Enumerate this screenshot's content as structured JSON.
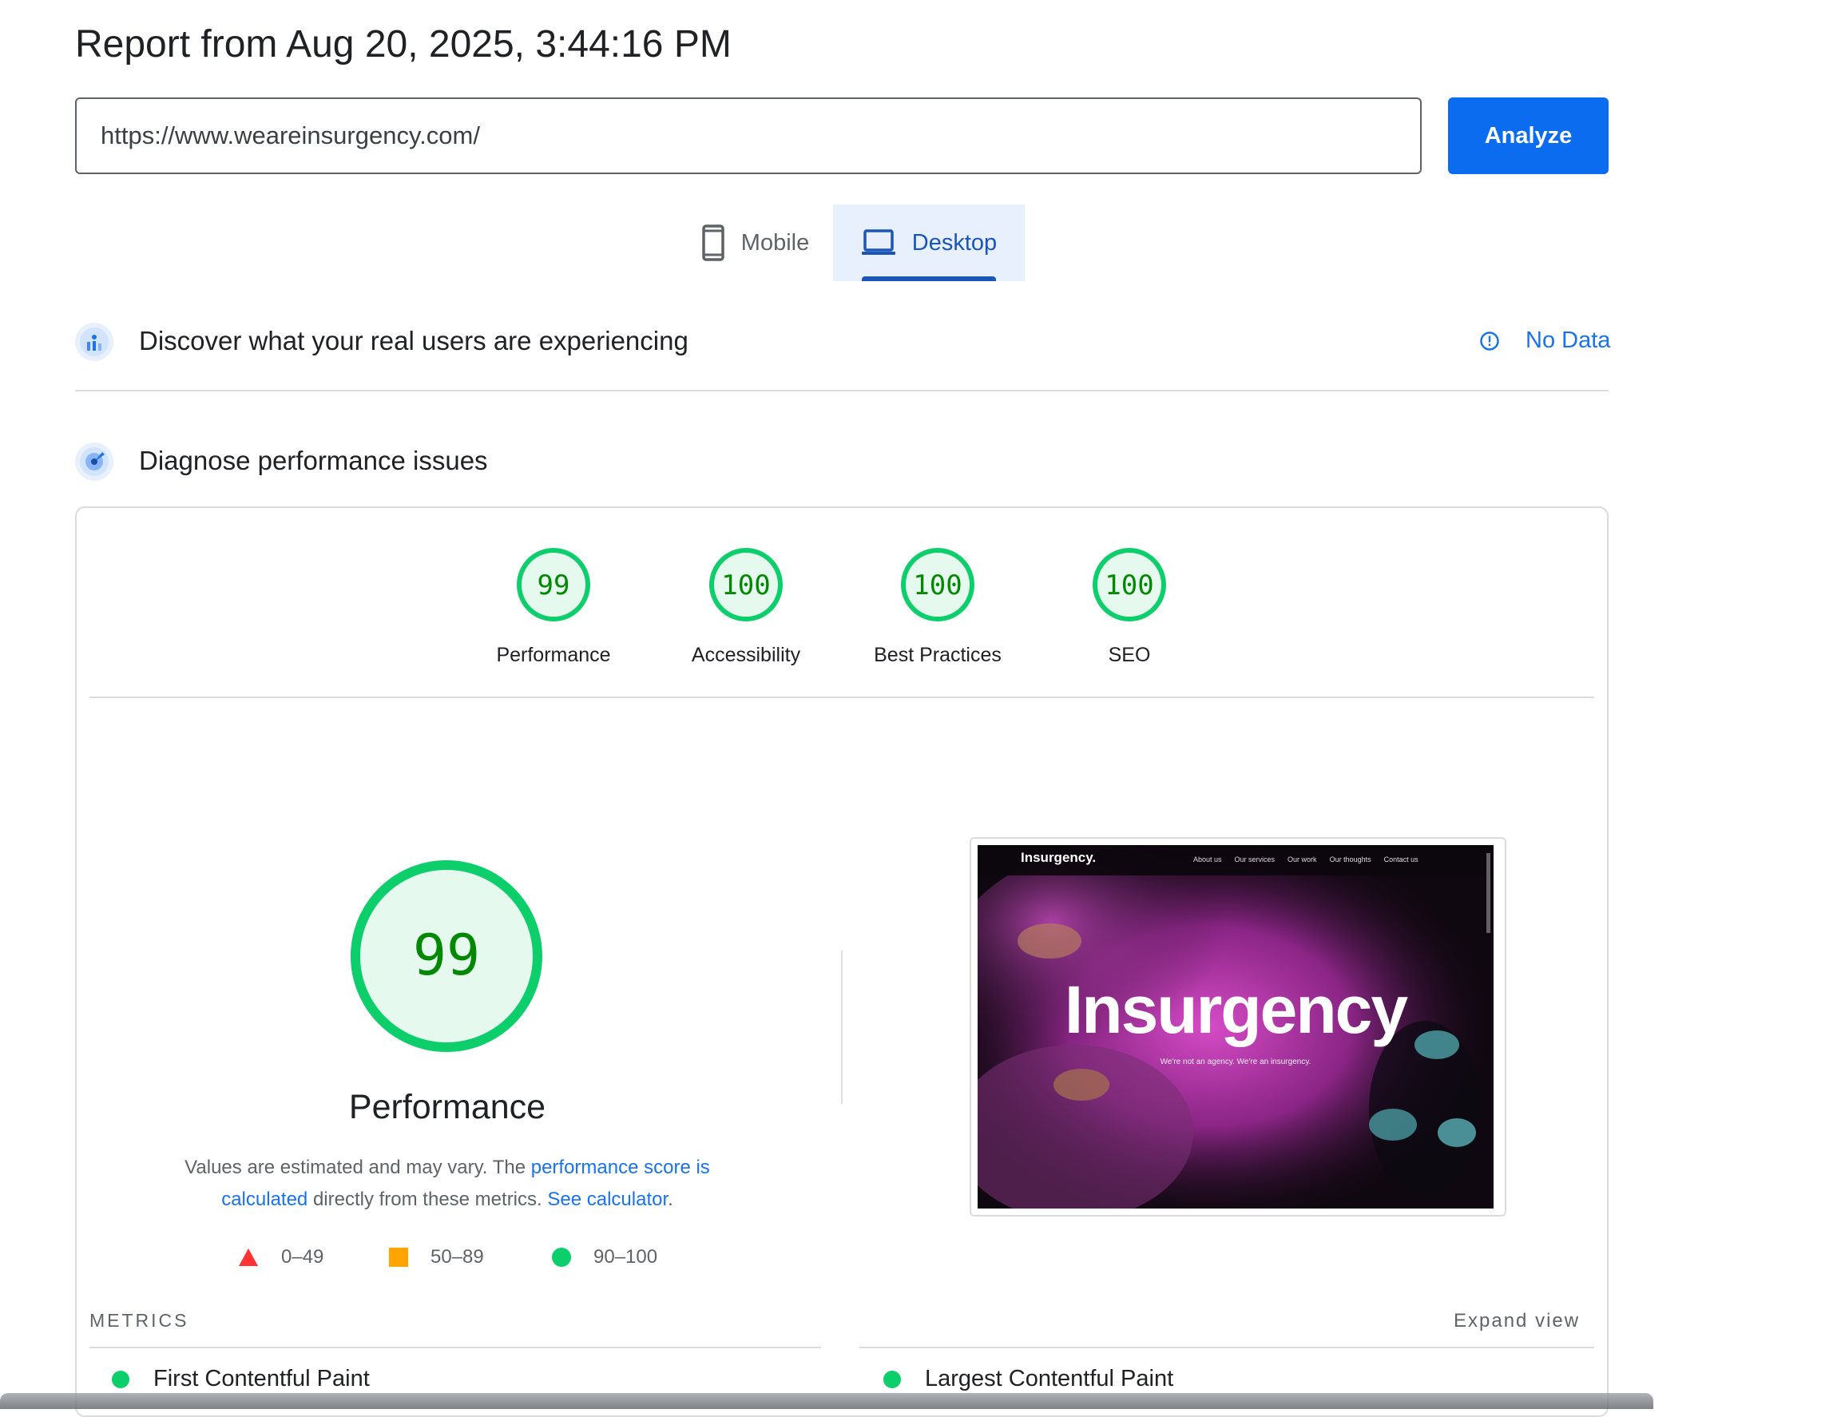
{
  "report": {
    "title": "Report from Aug 20, 2025, 3:44:16 PM"
  },
  "url_bar": {
    "value": "https://www.weareinsurgency.com/",
    "analyze_label": "Analyze"
  },
  "device_tabs": {
    "mobile": "Mobile",
    "desktop": "Desktop",
    "selected": "Desktop"
  },
  "field_data": {
    "heading": "Discover what your real users are experiencing",
    "status": "No Data"
  },
  "lab_data": {
    "heading": "Diagnose performance issues"
  },
  "categories": [
    {
      "label": "Performance",
      "score": "99"
    },
    {
      "label": "Accessibility",
      "score": "100"
    },
    {
      "label": "Best Practices",
      "score": "100"
    },
    {
      "label": "SEO",
      "score": "100"
    }
  ],
  "performance": {
    "score": "99",
    "title": "Performance",
    "desc_prefix": "Values are estimated and may vary. The ",
    "desc_link1": "performance score is calculated",
    "desc_mid": " directly from these metrics. ",
    "desc_link2": "See calculator",
    "desc_suffix": "."
  },
  "legend": {
    "fail": "0–49",
    "average": "50–89",
    "pass": "90–100"
  },
  "metrics": {
    "heading": "METRICS",
    "expand_label": "Expand view",
    "items": [
      "First Contentful Paint",
      "Largest Contentful Paint"
    ]
  },
  "screenshot": {
    "logo": "Insurgency.",
    "nav": [
      "About us",
      "Our services",
      "Our work",
      "Our thoughts",
      "Contact us"
    ],
    "hero": "Insurgency",
    "tagline": "We're not an agency. We're an insurgency."
  },
  "colors": {
    "pass": "#0cce6b",
    "average": "#ffa400",
    "fail": "#ff4e42",
    "accent": "#1a73e8"
  }
}
